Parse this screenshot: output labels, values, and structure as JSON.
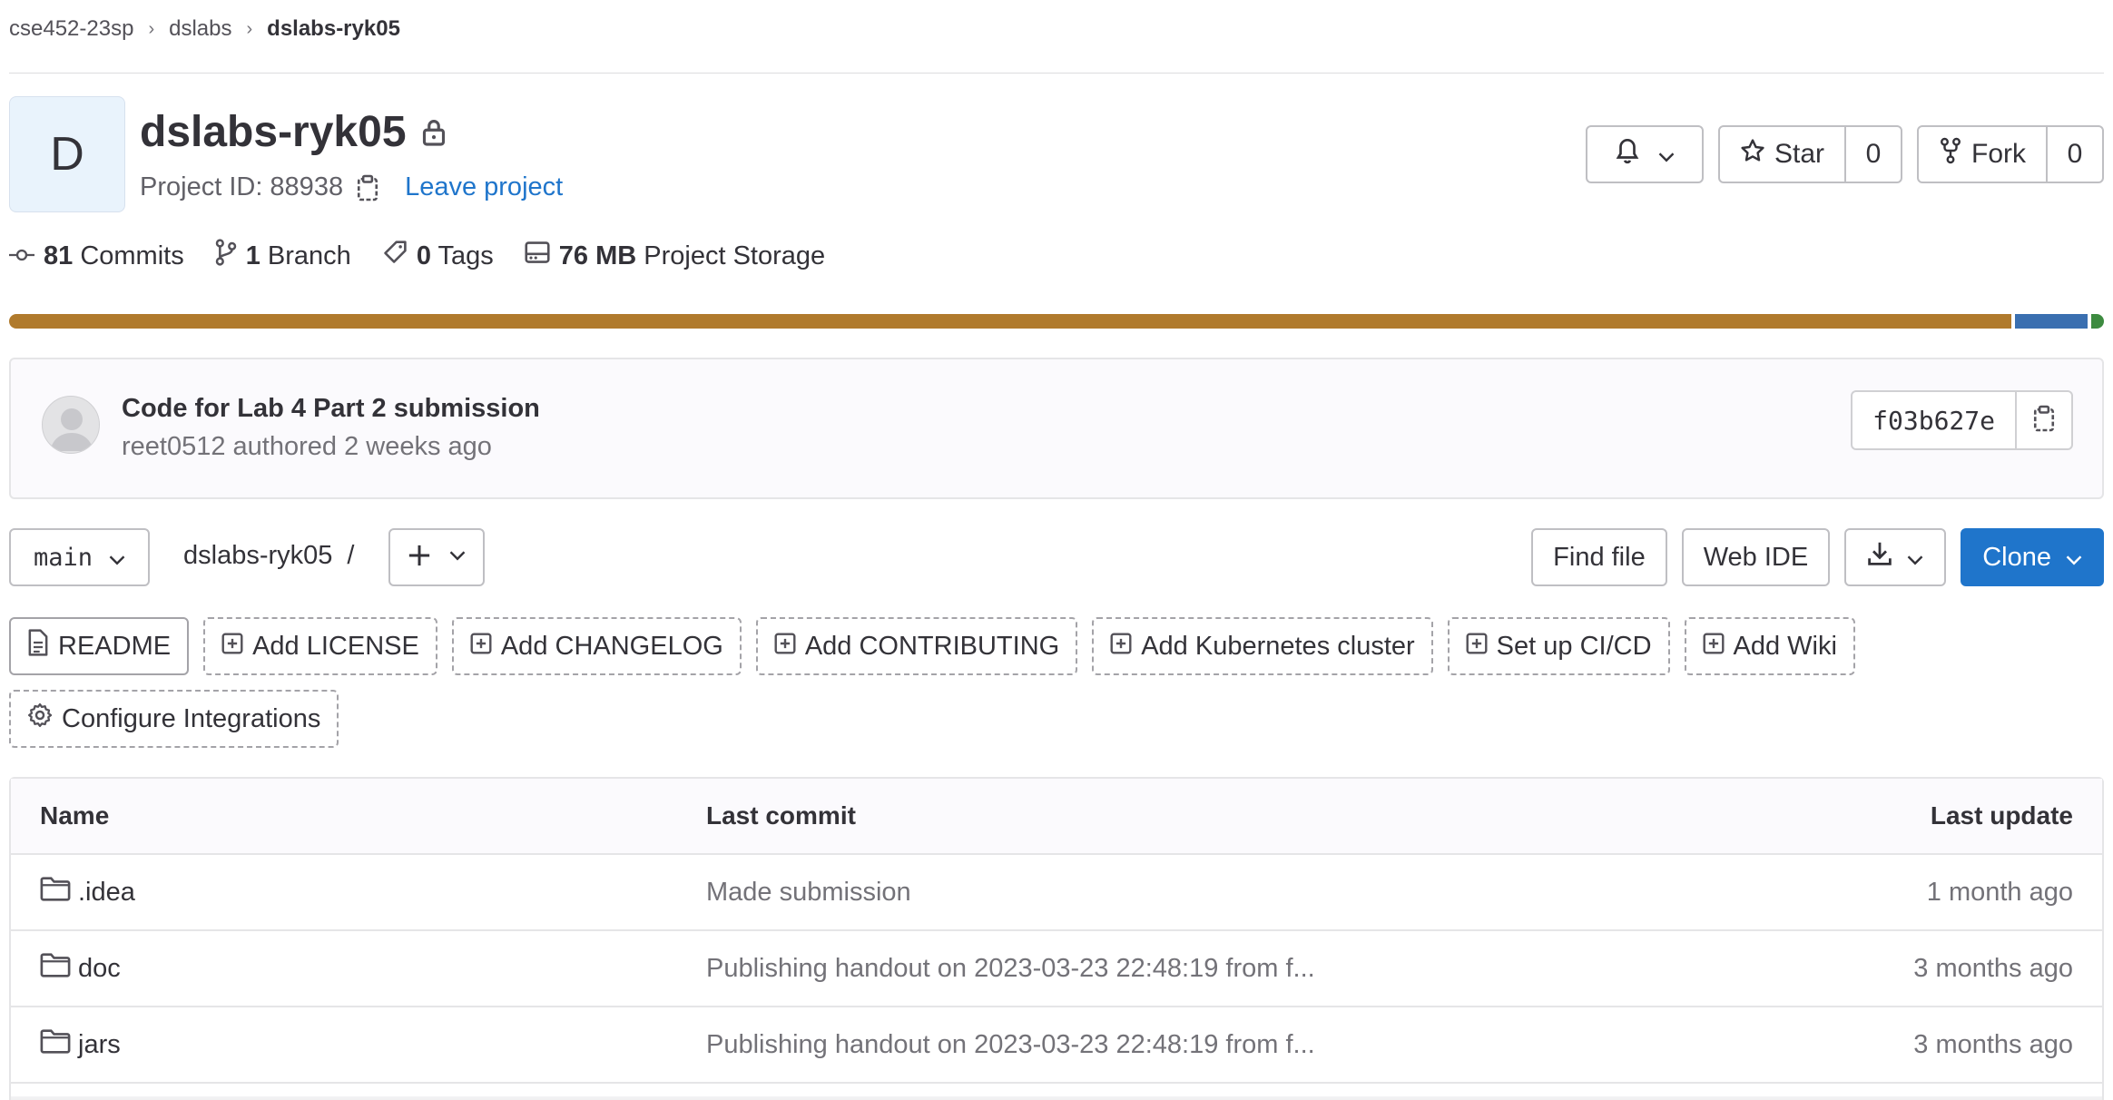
{
  "breadcrumb": {
    "group": "cse452-23sp",
    "subgroup": "dslabs",
    "project": "dslabs-ryk05"
  },
  "project": {
    "avatar_letter": "D",
    "name": "dslabs-ryk05",
    "id_label": "Project ID: 88938",
    "leave_label": "Leave project"
  },
  "actions": {
    "star_label": "Star",
    "star_count": "0",
    "fork_label": "Fork",
    "fork_count": "0"
  },
  "stats": {
    "commits_count": "81",
    "commits_label": "Commits",
    "branch_count": "1",
    "branch_label": "Branch",
    "tags_count": "0",
    "tags_label": "Tags",
    "storage_size": "76 MB",
    "storage_label": "Project Storage"
  },
  "language_colors": [
    "#b07a2c",
    "#3a6fb0",
    "#3d8b40"
  ],
  "last_commit": {
    "title": "Code for Lab 4 Part 2 submission",
    "meta": "reet0512 authored 2 weeks ago",
    "sha": "f03b627e"
  },
  "toolbar": {
    "branch": "main",
    "path": "dslabs-ryk05",
    "path_sep": "/",
    "find_file": "Find file",
    "web_ide": "Web IDE",
    "clone": "Clone"
  },
  "shortcuts": {
    "readme": "README",
    "license": "Add LICENSE",
    "changelog": "Add CHANGELOG",
    "contributing": "Add CONTRIBUTING",
    "kubernetes": "Add Kubernetes cluster",
    "cicd": "Set up CI/CD",
    "wiki": "Add Wiki",
    "integrations": "Configure Integrations"
  },
  "table": {
    "headers": {
      "name": "Name",
      "commit": "Last commit",
      "date": "Last update"
    },
    "rows": [
      {
        "name": ".idea",
        "commit": "Made submission",
        "date": "1 month ago"
      },
      {
        "name": "doc",
        "commit": "Publishing handout on 2023-03-23 22:48:19 from f...",
        "date": "3 months ago"
      },
      {
        "name": "jars",
        "commit": "Publishing handout on 2023-03-23 22:48:19 from f...",
        "date": "3 months ago"
      }
    ]
  },
  "accent": "#1f75cb"
}
